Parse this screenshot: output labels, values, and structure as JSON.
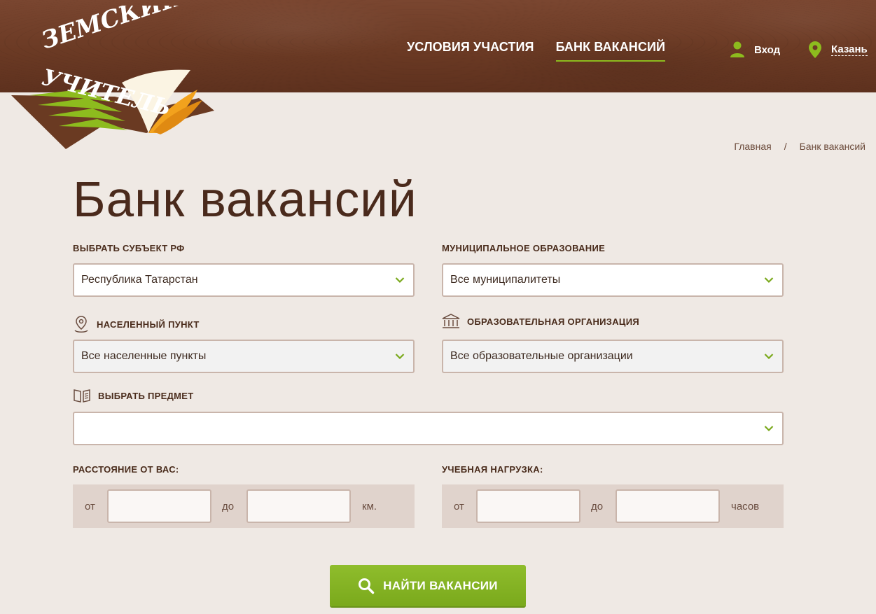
{
  "header": {
    "nav": [
      "УСЛОВИЯ УЧАСТИЯ",
      "БАНК ВАКАНСИЙ"
    ],
    "login_label": "Вход",
    "city_label": "Казань"
  },
  "logo": {
    "line1": "ЗЕМСКИЙ",
    "line2": "УЧИТЕЛЬ"
  },
  "breadcrumb": {
    "home": "Главная",
    "separator": "/",
    "current": "Банк вакансий"
  },
  "page_title": "Банк вакансий",
  "filters": {
    "region_label": "ВЫБРАТЬ СУБЪЕКТ РФ",
    "region_value": "Республика Татарстан",
    "municipality_label": "МУНИЦИПАЛЬНОЕ ОБРАЗОВАНИЕ",
    "municipality_value": "Все муниципалитеты",
    "settlement_label": "НАСЕЛЕННЫЙ ПУНКТ",
    "settlement_value": "Все населенные пункты",
    "organization_label": "ОБРАЗОВАТЕЛЬНАЯ ОРГАНИЗАЦИЯ",
    "organization_value": "Все образовательные организации",
    "subject_label": "ВЫБРАТЬ ПРЕДМЕТ",
    "subject_value": "",
    "distance_label": "РАССТОЯНИЕ ОТ ВАС:",
    "distance_from": "от",
    "distance_to": "до",
    "distance_unit": "км.",
    "load_label": "УЧЕБНАЯ НАГРУЗКА:",
    "load_from": "от",
    "load_to": "до",
    "load_unit": "часов"
  },
  "search_button": "НАЙТИ ВАКАНСИИ",
  "colors": {
    "accent_green": "#8dbb1e",
    "header_brown": "#6b3a24",
    "text_brown": "#4a2c1c"
  }
}
